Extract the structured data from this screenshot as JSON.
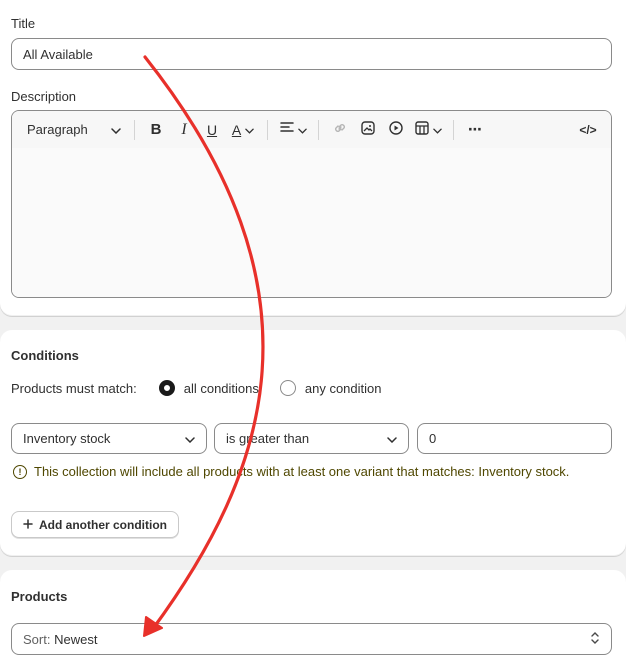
{
  "title_section": {
    "label": "Title",
    "value": "All Available"
  },
  "description_section": {
    "label": "Description",
    "toolbar": {
      "paragraph_label": "Paragraph",
      "bold": "B",
      "italic": "I",
      "underline": "U",
      "text_color": "A",
      "more": "⋯",
      "code": "</>"
    }
  },
  "conditions": {
    "heading": "Conditions",
    "match_label": "Products must match:",
    "options": [
      "all conditions",
      "any condition"
    ],
    "selected_option": "all conditions",
    "field_select": "Inventory stock",
    "operator_select": "is greater than",
    "value_input": "0",
    "warning": "This collection will include all products with at least one variant that matches: Inventory stock.",
    "add_button": "Add another condition"
  },
  "products": {
    "heading": "Products",
    "sort_prefix": "Sort:",
    "sort_value": "Newest"
  },
  "colors": {
    "annotation_arrow": "#e8302a",
    "warning_text": "#4f4700"
  }
}
